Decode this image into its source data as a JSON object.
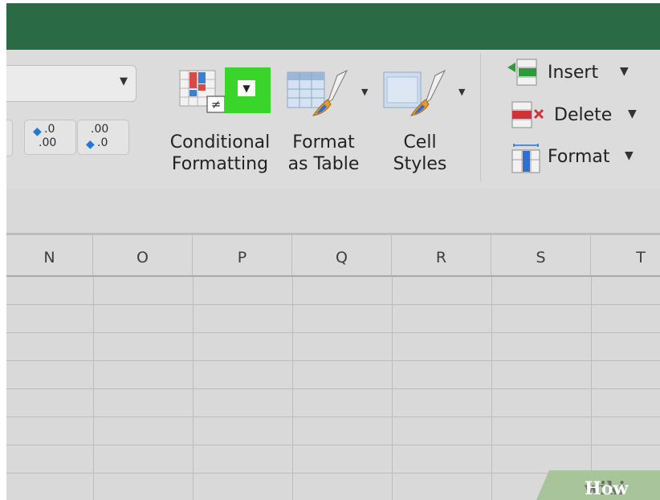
{
  "ribbon": {
    "conditional_formatting": {
      "line1": "Conditional",
      "line2": "Formatting",
      "icon": "conditional-formatting-icon"
    },
    "format_as_table": {
      "line1": "Format",
      "line2": "as Table",
      "icon": "format-as-table-icon"
    },
    "cell_styles": {
      "line1": "Cell",
      "line2": "Styles",
      "icon": "cell-styles-icon"
    },
    "increase_decimal": {
      "top": ".0",
      "bottom": ".00"
    },
    "decrease_decimal": {
      "top": ".00",
      "bottom": ".0"
    },
    "cells": {
      "insert": "Insert",
      "delete": "Delete",
      "format": "Format"
    }
  },
  "columns": [
    "N",
    "O",
    "P",
    "Q",
    "R",
    "S",
    "T"
  ],
  "watermark": {
    "part1": "wiki",
    "part2": "How"
  },
  "colors": {
    "title_bar": "#2a6b45",
    "highlight": "#39d52a",
    "ribbon_bg": "#dcdcdc",
    "grid_bg": "#d9d9d9",
    "accent_blue": "#1f7ad6",
    "delete_red": "#d0323a",
    "insert_green": "#2e9a3a"
  }
}
